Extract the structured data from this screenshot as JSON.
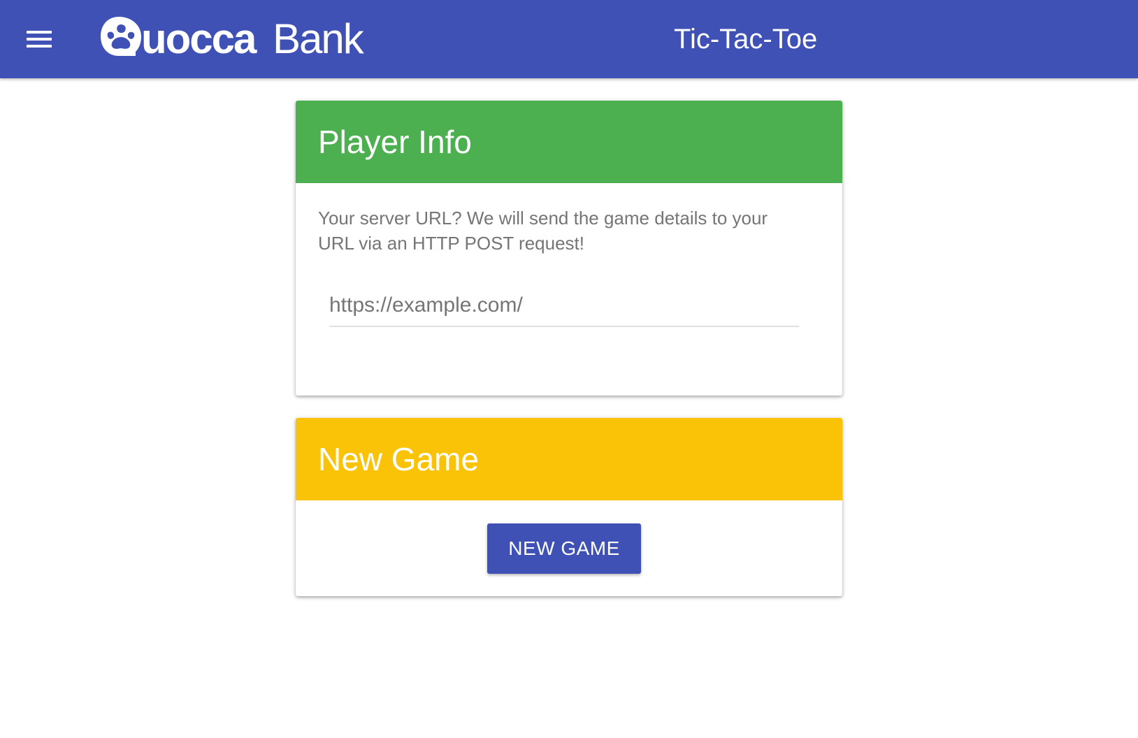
{
  "app_bar": {
    "menu_icon": "hamburger-menu-icon",
    "logo_text": "QuoccaBank",
    "title": "Tic-Tac-Toe",
    "color": "#3f51b5"
  },
  "player_info": {
    "title": "Player Info",
    "description": "Your server URL? We will send the game details to your URL via an HTTP POST request!",
    "url_input": {
      "value": "",
      "placeholder": "https://example.com/"
    },
    "header_color": "#4caf50"
  },
  "new_game": {
    "title": "New Game",
    "button_label": "NEW GAME",
    "header_color": "#fbc308"
  }
}
